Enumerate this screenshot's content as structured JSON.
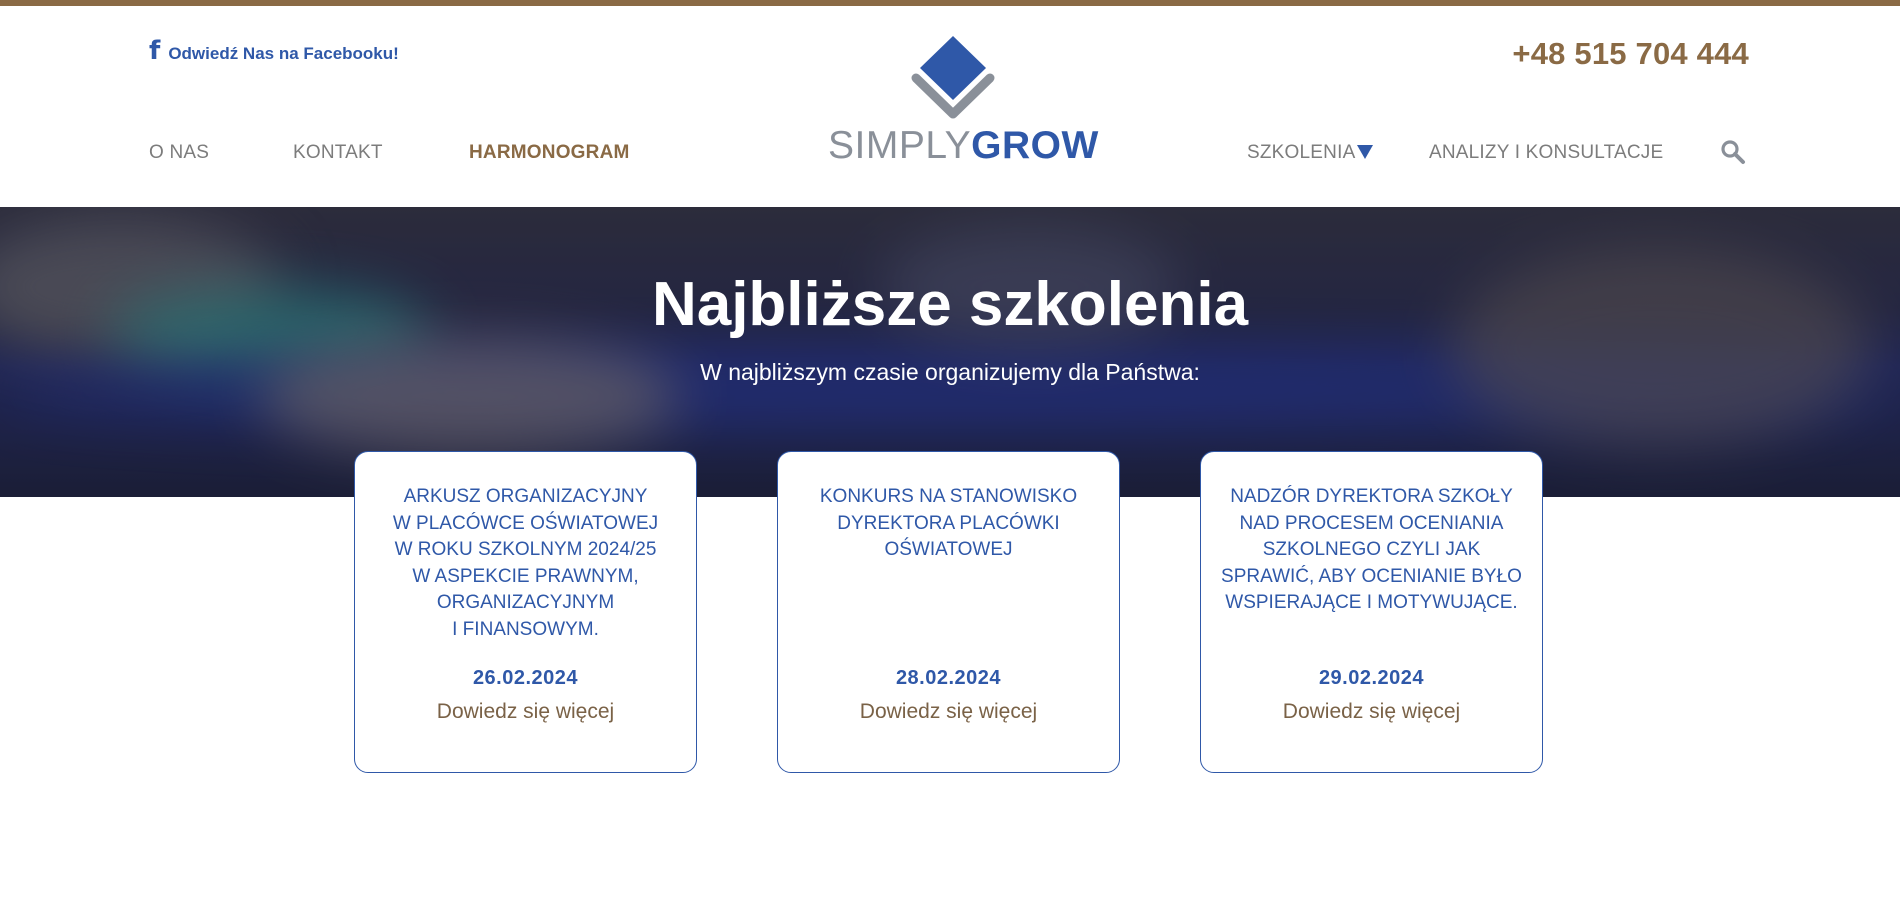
{
  "header": {
    "facebook_icon": "facebook-icon",
    "facebook_label": "Odwiedź Nas na Facebooku!",
    "phone": "+48 515 704 444",
    "logo": {
      "part1": "SIMPLY",
      "part2": "GROW"
    },
    "nav_left": [
      "O NAS",
      "KONTAKT",
      "HARMONOGRAM"
    ],
    "nav_active": "HARMONOGRAM",
    "nav_right": [
      "SZKOLENIA",
      "ANALIZY I KONSULTACJE"
    ],
    "dropdown_icon": "caret-down-icon",
    "search_icon": "search-icon"
  },
  "hero": {
    "title": "Najbliższe szkolenia",
    "subtitle": "W najbliższym czasie organizujemy dla Państwa:"
  },
  "cards": [
    {
      "title": "ARKUSZ ORGANIZACYJNY\nW PLACÓWCE OŚWIATOWEJ\nW ROKU SZKOLNYM 2024/25\nW ASPEKCIE PRAWNYM, ORGANIZACYJNYM\nI FINANSOWYM.",
      "date": "26.02.2024",
      "link": "Dowiedz się więcej"
    },
    {
      "title": "KONKURS NA STANOWISKO\nDYREKTORA PLACÓWKI\nOŚWIATOWEJ",
      "date": "28.02.2024",
      "link": "Dowiedz się więcej"
    },
    {
      "title": "NADZÓR DYREKTORA SZKOŁY\nNAD PROCESEM OCENIANIA\nSZKOLNEGO CZYLI JAK\nSPRAWIĆ, ABY OCENIANIE BYŁO\nWSPIERAJĄCE I MOTYWUJĄCE.",
      "date": "29.02.2024",
      "link": "Dowiedz się więcej"
    }
  ],
  "colors": {
    "accent_brown": "#8a6a45",
    "brand_blue": "#2f58a8",
    "nav_gray": "#7c7c7c",
    "logo_gray": "#8a9099"
  }
}
